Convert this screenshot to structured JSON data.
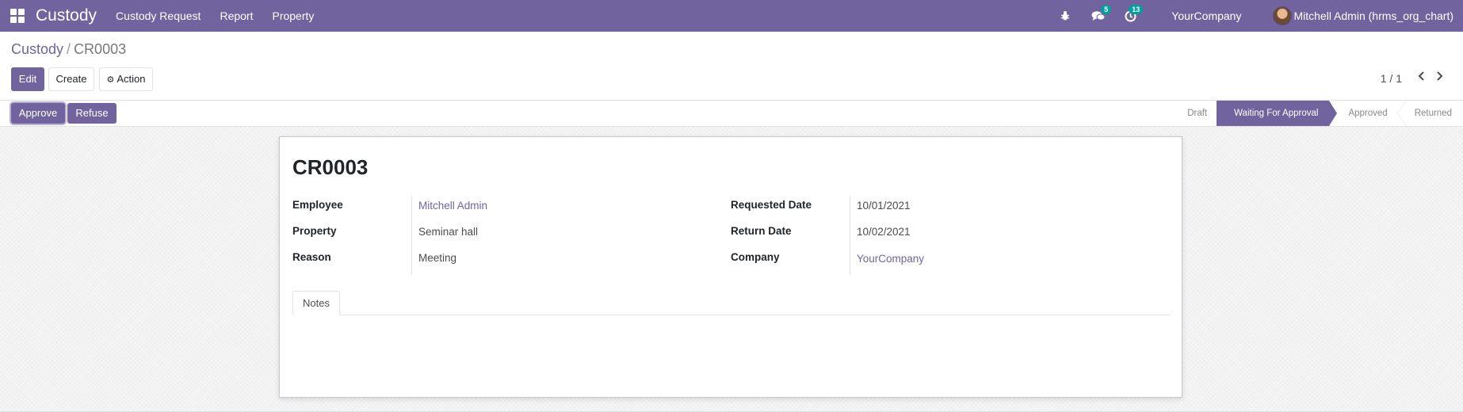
{
  "app": {
    "brand": "Custody",
    "menu": [
      {
        "label": "Custody Request"
      },
      {
        "label": "Report"
      },
      {
        "label": "Property"
      }
    ],
    "systray": {
      "debug_icon": "bug-icon",
      "messages_icon": "chat-icon",
      "messages_count": "5",
      "activities_icon": "clock-icon",
      "activities_count": "13",
      "company": "YourCompany",
      "user": "Mitchell Admin (hrms_org_chart)"
    }
  },
  "breadcrumb": {
    "parent": "Custody",
    "separator": "/",
    "current": "CR0003"
  },
  "toolbar": {
    "edit_label": "Edit",
    "create_label": "Create",
    "action_icon": "gear-icon",
    "action_label": "Action",
    "pager": "1 / 1"
  },
  "statusbar": {
    "approve_label": "Approve",
    "refuse_label": "Refuse",
    "stages": [
      {
        "label": "Draft",
        "active": false
      },
      {
        "label": "Waiting For Approval",
        "active": true
      },
      {
        "label": "Approved",
        "active": false
      },
      {
        "label": "Returned",
        "active": false
      }
    ]
  },
  "record": {
    "name": "CR0003",
    "left_fields": [
      {
        "label": "Employee",
        "value": "Mitchell Admin",
        "link": true
      },
      {
        "label": "Property",
        "value": "Seminar hall",
        "link": false
      },
      {
        "label": "Reason",
        "value": "Meeting",
        "link": false
      }
    ],
    "right_fields": [
      {
        "label": "Requested Date",
        "value": "10/01/2021",
        "link": false
      },
      {
        "label": "Return Date",
        "value": "10/02/2021",
        "link": false
      },
      {
        "label": "Company",
        "value": "YourCompany",
        "link": true
      }
    ],
    "tabs": [
      {
        "label": "Notes"
      }
    ]
  },
  "colors": {
    "brand": "#71639e",
    "badge": "#00a09d"
  }
}
